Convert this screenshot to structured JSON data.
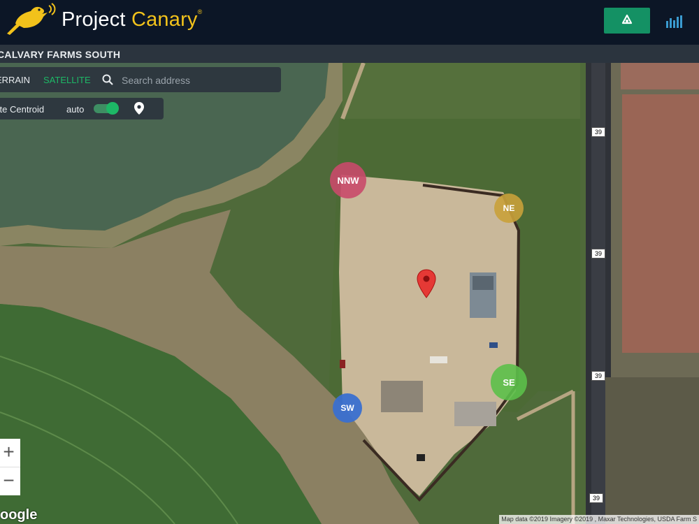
{
  "header": {
    "logo_text_1": "Project",
    "logo_text_2": "Canary",
    "logo_reg": "®",
    "site_title": "CALVARY FARMS SOUTH"
  },
  "map_controls": {
    "tab_terrain": "TERRAIN",
    "tab_satellite": "SATELLITE",
    "search_placeholder": "Search address",
    "centroid_label": "Site Centroid",
    "auto_label": "auto",
    "auto_enabled": true,
    "zoom_in": "+",
    "zoom_out": "−"
  },
  "sensors": [
    {
      "label": "NNW",
      "color": "#c94a6a"
    },
    {
      "label": "NE",
      "color": "#c9a13a"
    },
    {
      "label": "SE",
      "color": "#5cc04a"
    },
    {
      "label": "SW",
      "color": "#3a6fd0"
    }
  ],
  "highway_label": "39",
  "map_footer": {
    "google": "oogle",
    "attribution": "Map data ©2019 Imagery ©2019 , Maxar Technologies, USDA Farm S"
  },
  "colors": {
    "brand_yellow": "#f2c21b",
    "header_bg": "#0c1626",
    "recycle_button": "#149164",
    "satellite_active": "#1db866"
  }
}
